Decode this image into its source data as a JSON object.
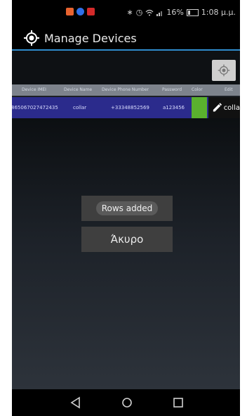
{
  "status_bar": {
    "battery_percent": "16%",
    "time": "1:08 μ.μ.",
    "icons": [
      "notification-icon-1",
      "notification-icon-2",
      "notification-icon-3",
      "bluetooth-icon",
      "alarm-icon",
      "wifi-icon",
      "signal-icon",
      "battery-icon"
    ],
    "notification_colors": [
      "#e8632f",
      "#2f6fe8",
      "#d42a2a"
    ]
  },
  "app_bar": {
    "title": "Manage Devices",
    "icon": "crosshair-icon",
    "accent_color": "#2f8ccd"
  },
  "table": {
    "columns": [
      "Device IMEI",
      "Device Name",
      "Device Phone Number",
      "Password",
      "Color",
      "Edit"
    ],
    "rows": [
      {
        "imei": "865067027472435",
        "name": "collar",
        "phone": "+33348852569",
        "password": "a123456",
        "color": "#5ab02e",
        "edit_label": "colla"
      }
    ]
  },
  "toast": {
    "message": "Rows added"
  },
  "dialog": {
    "cancel_label": "Άκυρο"
  },
  "nav_bar": {
    "icons": [
      "back-icon",
      "home-icon",
      "recents-icon"
    ]
  }
}
